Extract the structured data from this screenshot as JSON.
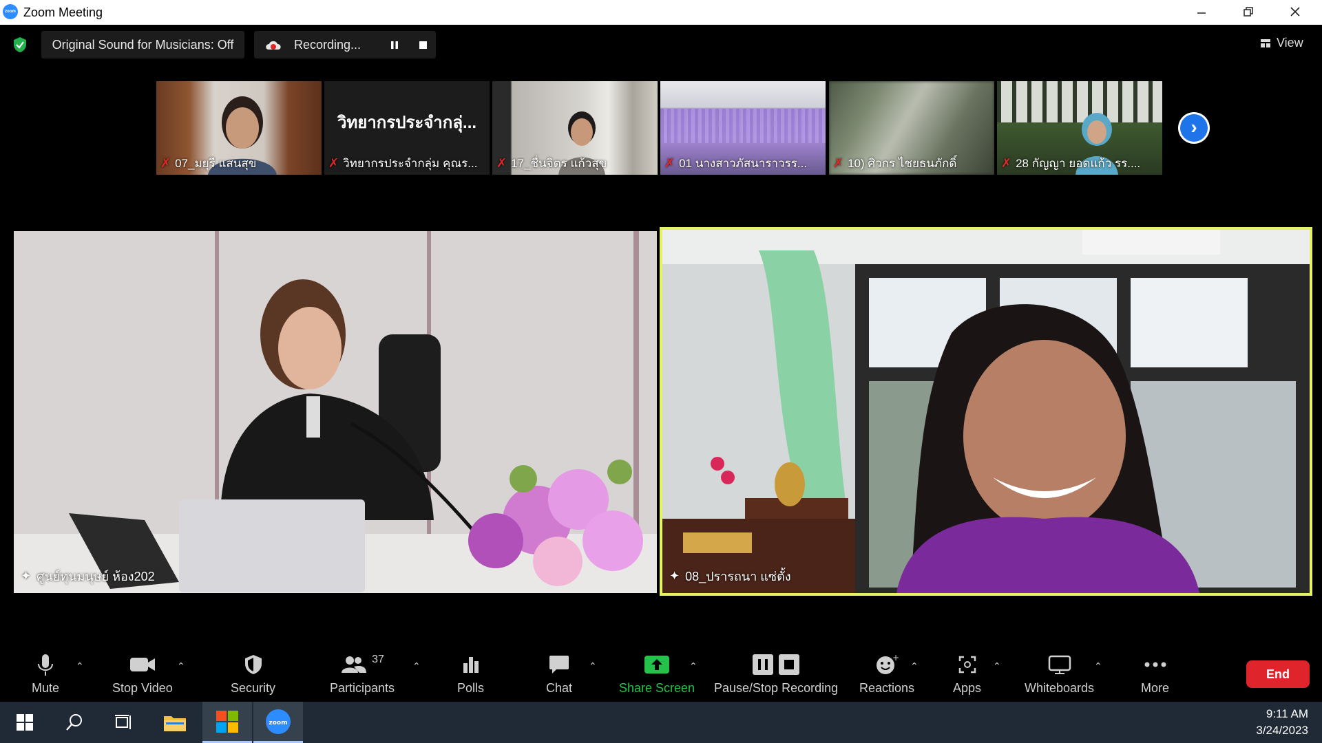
{
  "window": {
    "title": "Zoom Meeting",
    "logo_text": "zoom"
  },
  "status_bar": {
    "original_sound": "Original Sound for Musicians: Off",
    "recording": "Recording...",
    "view": "View"
  },
  "thumbnails": [
    {
      "name": "07_มยุรี แสนสุข"
    },
    {
      "name": "วิทยากรประจำกลุ่ม คุณร...",
      "display_text": "วิทยากรประจำกลุ่..."
    },
    {
      "name": "17_ชื่นจิตร แก้วสุข"
    },
    {
      "name": "01 นางสาวภัสนาราวรร..."
    },
    {
      "name": "10) ศิวกร ไชยธนภักดิ์"
    },
    {
      "name": "28 กัญญา  ยอดแก้ว รร...."
    }
  ],
  "main_tiles": [
    {
      "name": "ศูนย์ทุนมนุษย์ ห้อง202"
    },
    {
      "name": "08_ปรารถนา แซ่ตั้ง"
    }
  ],
  "toolbar": {
    "mute": "Mute",
    "stop_video": "Stop Video",
    "security": "Security",
    "participants": "Participants",
    "participants_count": "37",
    "polls": "Polls",
    "chat": "Chat",
    "share_screen": "Share Screen",
    "pause_stop_recording": "Pause/Stop Recording",
    "reactions": "Reactions",
    "apps": "Apps",
    "whiteboards": "Whiteboards",
    "more": "More",
    "end": "End"
  },
  "taskbar": {
    "time": "9:11 AM",
    "date": "3/24/2023"
  },
  "colors": {
    "active_speaker_border": "#e5f263",
    "share_screen_green": "#24c24a",
    "end_red": "#e0242b",
    "accent_blue": "#1e74e8"
  }
}
